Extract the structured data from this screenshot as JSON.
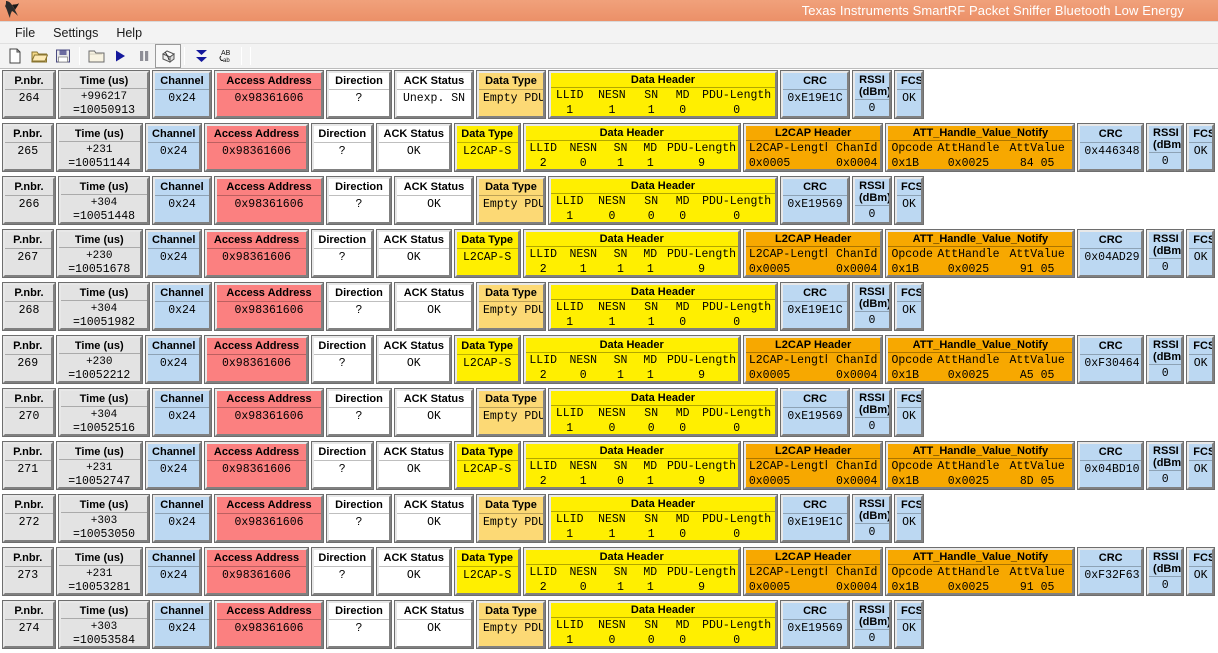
{
  "window": {
    "title": "Texas Instruments SmartRF Packet Sniffer Bluetooth Low Energy",
    "logo_icon": "ti-logo-icon"
  },
  "menubar": {
    "items": [
      {
        "label": "File"
      },
      {
        "label": "Settings"
      },
      {
        "label": "Help"
      }
    ]
  },
  "toolbar": {
    "buttons": [
      {
        "name": "new-file-icon",
        "title": "New"
      },
      {
        "name": "open-folder-icon",
        "title": "Open"
      },
      {
        "name": "save-disk-icon",
        "title": "Save"
      },
      {
        "name": "open-capture-icon",
        "title": "Open capture folder"
      },
      {
        "name": "play-icon",
        "title": "Start"
      },
      {
        "name": "pause-icon",
        "title": "Pause"
      },
      {
        "name": "clear-icon",
        "title": "Clear"
      },
      {
        "name": "scroll-down-icon",
        "title": "Scroll to end"
      },
      {
        "name": "ab-text-icon",
        "title": "Text view"
      }
    ]
  },
  "columns": {
    "pnbr": "P.nbr.",
    "time": "Time (us)",
    "channel": "Channel",
    "access_address": "Access Address",
    "direction": "Direction",
    "ack_status": "ACK Status",
    "data_type": "Data Type",
    "data_header": "Data Header",
    "data_header_subs": [
      "LLID",
      "NESN",
      "SN",
      "MD",
      "PDU-Length"
    ],
    "l2cap_header": "L2CAP Header",
    "l2cap_subs": [
      "L2CAP-Length",
      "ChanId"
    ],
    "att_notify": "ATT_Handle_Value_Notify",
    "att_subs": [
      "Opcode",
      "AttHandle",
      "AttValue"
    ],
    "crc": "CRC",
    "rssi_line1": "RSSI",
    "rssi_line2": "(dBm)",
    "fcs": "FCS"
  },
  "colors": {
    "titlebar": "#ee9a72",
    "grey": "#e3e3e3",
    "blue": "#bcd8f2",
    "red": "#fb8080",
    "yellow": "#ffef00",
    "sand": "#fcd975",
    "orange": "#f7a800"
  },
  "packets": [
    {
      "pnbr": "264",
      "time_delta": "+996217",
      "time_abs": "=10050913",
      "channel": "0x24",
      "access_address": "0x98361606",
      "direction": "?",
      "ack_status": "Unexp. SN",
      "data_type": "Empty PDU",
      "data_type_style": "sand",
      "dh": {
        "llid": "1",
        "nesn": "1",
        "sn": "1",
        "md": "0",
        "pdu": "0"
      },
      "has_l2cap": false,
      "crc": "0xE19E1C",
      "rssi": "0",
      "fcs": "OK"
    },
    {
      "pnbr": "265",
      "time_delta": "+231",
      "time_abs": "=10051144",
      "channel": "0x24",
      "access_address": "0x98361606",
      "direction": "?",
      "ack_status": "OK",
      "data_type": "L2CAP-S",
      "data_type_style": "yellow",
      "dh": {
        "llid": "2",
        "nesn": "0",
        "sn": "1",
        "md": "1",
        "pdu": "9"
      },
      "has_l2cap": true,
      "l2cap": {
        "length": "0x0005",
        "chanid": "0x0004"
      },
      "att": {
        "opcode": "0x1B",
        "handle": "0x0025",
        "value": "84 05"
      },
      "crc": "0x446348",
      "rssi": "0",
      "fcs": "OK"
    },
    {
      "pnbr": "266",
      "time_delta": "+304",
      "time_abs": "=10051448",
      "channel": "0x24",
      "access_address": "0x98361606",
      "direction": "?",
      "ack_status": "OK",
      "data_type": "Empty PDU",
      "data_type_style": "sand",
      "dh": {
        "llid": "1",
        "nesn": "0",
        "sn": "0",
        "md": "0",
        "pdu": "0"
      },
      "has_l2cap": false,
      "crc": "0xE19569",
      "rssi": "0",
      "fcs": "OK"
    },
    {
      "pnbr": "267",
      "time_delta": "+230",
      "time_abs": "=10051678",
      "channel": "0x24",
      "access_address": "0x98361606",
      "direction": "?",
      "ack_status": "OK",
      "data_type": "L2CAP-S",
      "data_type_style": "yellow",
      "dh": {
        "llid": "2",
        "nesn": "1",
        "sn": "1",
        "md": "1",
        "pdu": "9"
      },
      "has_l2cap": true,
      "l2cap": {
        "length": "0x0005",
        "chanid": "0x0004"
      },
      "att": {
        "opcode": "0x1B",
        "handle": "0x0025",
        "value": "91 05"
      },
      "crc": "0x04AD29",
      "rssi": "0",
      "fcs": "OK"
    },
    {
      "pnbr": "268",
      "time_delta": "+304",
      "time_abs": "=10051982",
      "channel": "0x24",
      "access_address": "0x98361606",
      "direction": "?",
      "ack_status": "OK",
      "data_type": "Empty PDU",
      "data_type_style": "sand",
      "dh": {
        "llid": "1",
        "nesn": "1",
        "sn": "1",
        "md": "0",
        "pdu": "0"
      },
      "has_l2cap": false,
      "crc": "0xE19E1C",
      "rssi": "0",
      "fcs": "OK"
    },
    {
      "pnbr": "269",
      "time_delta": "+230",
      "time_abs": "=10052212",
      "channel": "0x24",
      "access_address": "0x98361606",
      "direction": "?",
      "ack_status": "OK",
      "data_type": "L2CAP-S",
      "data_type_style": "yellow",
      "dh": {
        "llid": "2",
        "nesn": "0",
        "sn": "1",
        "md": "1",
        "pdu": "9"
      },
      "has_l2cap": true,
      "l2cap": {
        "length": "0x0005",
        "chanid": "0x0004"
      },
      "att": {
        "opcode": "0x1B",
        "handle": "0x0025",
        "value": "A5 05"
      },
      "crc": "0xF30464",
      "rssi": "0",
      "fcs": "OK"
    },
    {
      "pnbr": "270",
      "time_delta": "+304",
      "time_abs": "=10052516",
      "channel": "0x24",
      "access_address": "0x98361606",
      "direction": "?",
      "ack_status": "OK",
      "data_type": "Empty PDU",
      "data_type_style": "sand",
      "dh": {
        "llid": "1",
        "nesn": "0",
        "sn": "0",
        "md": "0",
        "pdu": "0"
      },
      "has_l2cap": false,
      "crc": "0xE19569",
      "rssi": "0",
      "fcs": "OK"
    },
    {
      "pnbr": "271",
      "time_delta": "+231",
      "time_abs": "=10052747",
      "channel": "0x24",
      "access_address": "0x98361606",
      "direction": "?",
      "ack_status": "OK",
      "data_type": "L2CAP-S",
      "data_type_style": "yellow",
      "dh": {
        "llid": "2",
        "nesn": "1",
        "sn": "0",
        "md": "1",
        "pdu": "9"
      },
      "has_l2cap": true,
      "l2cap": {
        "length": "0x0005",
        "chanid": "0x0004"
      },
      "att": {
        "opcode": "0x1B",
        "handle": "0x0025",
        "value": "8D 05"
      },
      "crc": "0x04BD10",
      "rssi": "0",
      "fcs": "OK"
    },
    {
      "pnbr": "272",
      "time_delta": "+303",
      "time_abs": "=10053050",
      "channel": "0x24",
      "access_address": "0x98361606",
      "direction": "?",
      "ack_status": "OK",
      "data_type": "Empty PDU",
      "data_type_style": "sand",
      "dh": {
        "llid": "1",
        "nesn": "1",
        "sn": "1",
        "md": "0",
        "pdu": "0"
      },
      "has_l2cap": false,
      "crc": "0xE19E1C",
      "rssi": "0",
      "fcs": "OK"
    },
    {
      "pnbr": "273",
      "time_delta": "+231",
      "time_abs": "=10053281",
      "channel": "0x24",
      "access_address": "0x98361606",
      "direction": "?",
      "ack_status": "OK",
      "data_type": "L2CAP-S",
      "data_type_style": "yellow",
      "dh": {
        "llid": "2",
        "nesn": "0",
        "sn": "1",
        "md": "1",
        "pdu": "9"
      },
      "has_l2cap": true,
      "l2cap": {
        "length": "0x0005",
        "chanid": "0x0004"
      },
      "att": {
        "opcode": "0x1B",
        "handle": "0x0025",
        "value": "91 05"
      },
      "crc": "0xF32F63",
      "rssi": "0",
      "fcs": "OK"
    },
    {
      "pnbr": "274",
      "time_delta": "+303",
      "time_abs": "=10053584",
      "channel": "0x24",
      "access_address": "0x98361606",
      "direction": "?",
      "ack_status": "OK",
      "data_type": "Empty PDU",
      "data_type_style": "sand",
      "dh": {
        "llid": "1",
        "nesn": "0",
        "sn": "0",
        "md": "0",
        "pdu": "0"
      },
      "has_l2cap": false,
      "crc": "0xE19569",
      "rssi": "0",
      "fcs": "OK"
    }
  ]
}
